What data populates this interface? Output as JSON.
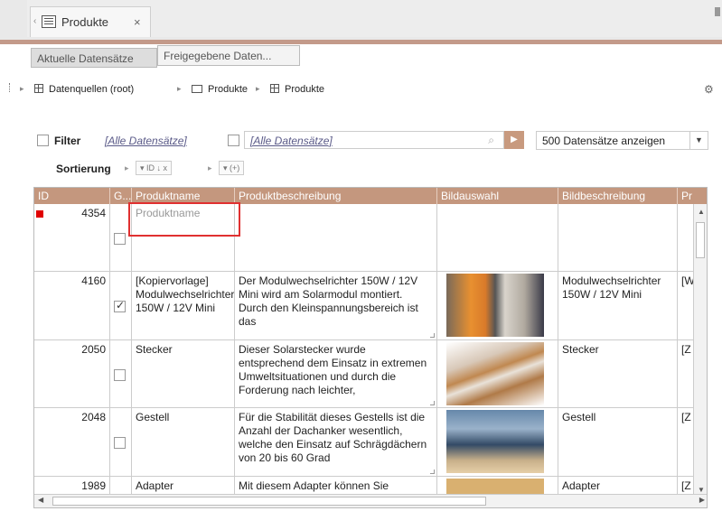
{
  "tabs": {
    "main_label": "Produkte",
    "close_glyph": "×"
  },
  "subtabs": [
    "Aktuelle Datensätze",
    "Freigegebene Daten..."
  ],
  "breadcrumb": {
    "root": "Datenquellen (root)",
    "folder": "Produkte",
    "table": "Produkte"
  },
  "filter": {
    "label": "Filter",
    "all_records_1": "[Alle Datensätze]",
    "all_records_2": "[Alle Datensätze]",
    "show_option": "500 Datensätze anzeigen"
  },
  "sort": {
    "label": "Sortierung",
    "chip1": "▾ ID   ↓ x",
    "chip2": "▾ (+)"
  },
  "grid": {
    "headers": [
      "ID",
      "G...",
      "Produktname",
      "Produktbeschreibung",
      "Bildauswahl",
      "Bildbeschreibung",
      "Pr"
    ],
    "rows": [
      {
        "id": "4354",
        "name": "Produktname",
        "desc": "",
        "imgdesc": "",
        "extra": "",
        "checked": false
      },
      {
        "id": "4160",
        "name": "[Kopiervorlage] Modulwechselrichter 150W / 12V Mini",
        "desc": "Der Modulwechselrichter 150W / 12V Mini wird am Solarmodul montiert. Durch den Kleinspannungsbereich ist das",
        "imgdesc": "Modulwechselrichter 150W / 12V Mini",
        "extra": "[W",
        "checked": true
      },
      {
        "id": "2050",
        "name": "Stecker",
        "desc": "Dieser Solarstecker wurde entsprechend dem Einsatz in extremen Umweltsituationen und durch die Forderung nach leichter,",
        "imgdesc": "Stecker",
        "extra": "[Z",
        "checked": false
      },
      {
        "id": "2048",
        "name": "Gestell",
        "desc": "Für die Stabilität dieses Gestells ist die Anzahl der Dachanker wesentlich, welche den Einsatz auf Schrägdächern von 20 bis 60 Grad",
        "imgdesc": "Gestell",
        "extra": "[Z",
        "checked": false
      },
      {
        "id": "1989",
        "name": "Adapter",
        "desc": "Mit diesem Adapter können Sie",
        "imgdesc": "Adapter",
        "extra": "[Z",
        "checked": false
      }
    ]
  },
  "colors": {
    "accent": "#c4977e",
    "marker": "#e00000"
  }
}
